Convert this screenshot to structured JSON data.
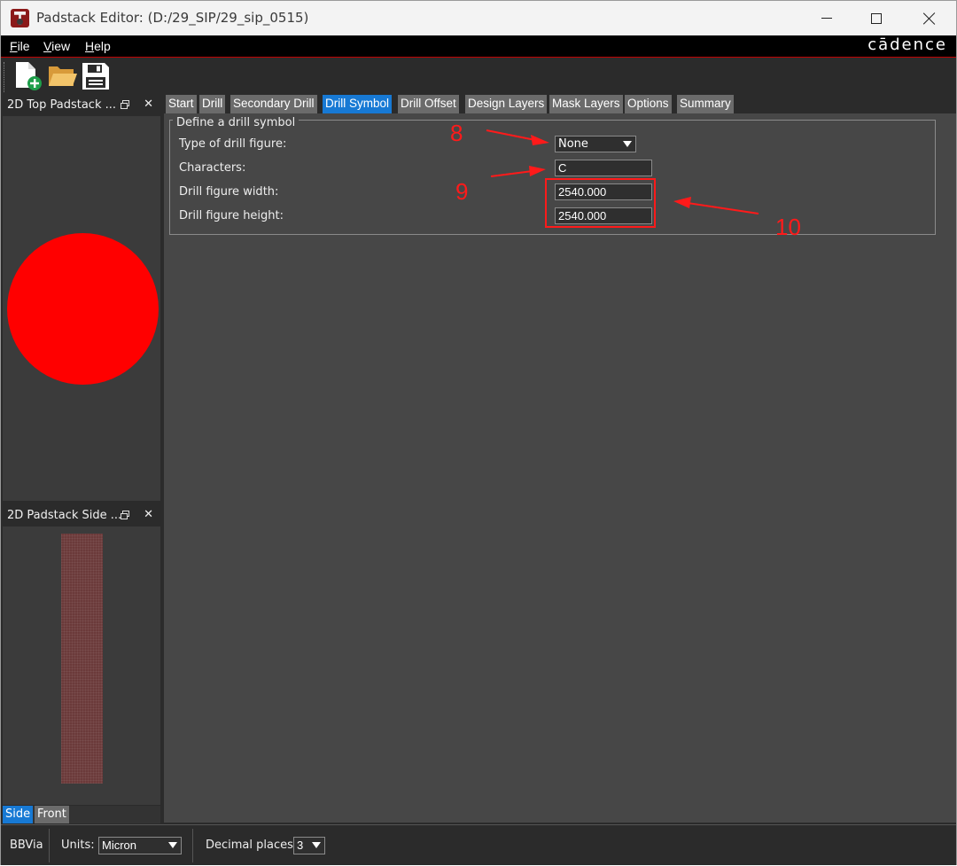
{
  "window": {
    "title": "Padstack Editor:  (D:/29_SIP/29_sip_0515)",
    "controls": [
      "minimize",
      "maximize",
      "close"
    ]
  },
  "menu": {
    "items": [
      {
        "label_u": "F",
        "label_rest": "ile"
      },
      {
        "label_u": "V",
        "label_rest": "iew"
      },
      {
        "label_u": "H",
        "label_rest": "elp"
      }
    ],
    "brand": "cādence"
  },
  "toolbar": {
    "buttons": [
      {
        "icon": "new-file-icon"
      },
      {
        "icon": "open-folder-icon"
      },
      {
        "icon": "save-icon"
      }
    ]
  },
  "left_dock": {
    "top_view_title": "2D Top Padstack ...",
    "side_view_title": "2D Padstack Side ...",
    "view_tabs": [
      "Side",
      "Front"
    ],
    "active_view_tab": "Side",
    "drill_color": "#ff0000"
  },
  "tabs": {
    "items": [
      "Start",
      "Drill",
      "Secondary Drill",
      "Drill Symbol",
      "Drill Offset",
      "Design Layers",
      "Mask Layers",
      "Options",
      "Summary"
    ],
    "active": "Drill Symbol"
  },
  "drill_symbol": {
    "group_title": "Define a drill symbol",
    "type_label": "Type of drill figure:",
    "type_value": "None",
    "characters_label": "Characters:",
    "characters_value": "C",
    "width_label": "Drill figure width:",
    "width_value": "2540.000",
    "height_label": "Drill figure height:",
    "height_value": "2540.000"
  },
  "statusbar": {
    "padstack_name": "BBVia",
    "units_label": "Units:",
    "units_value": "Micron",
    "decimal_label": "Decimal places:",
    "decimal_value": "3"
  },
  "annotations": {
    "numbers": [
      "8",
      "9",
      "10"
    ],
    "color": "#ff1a1a"
  }
}
